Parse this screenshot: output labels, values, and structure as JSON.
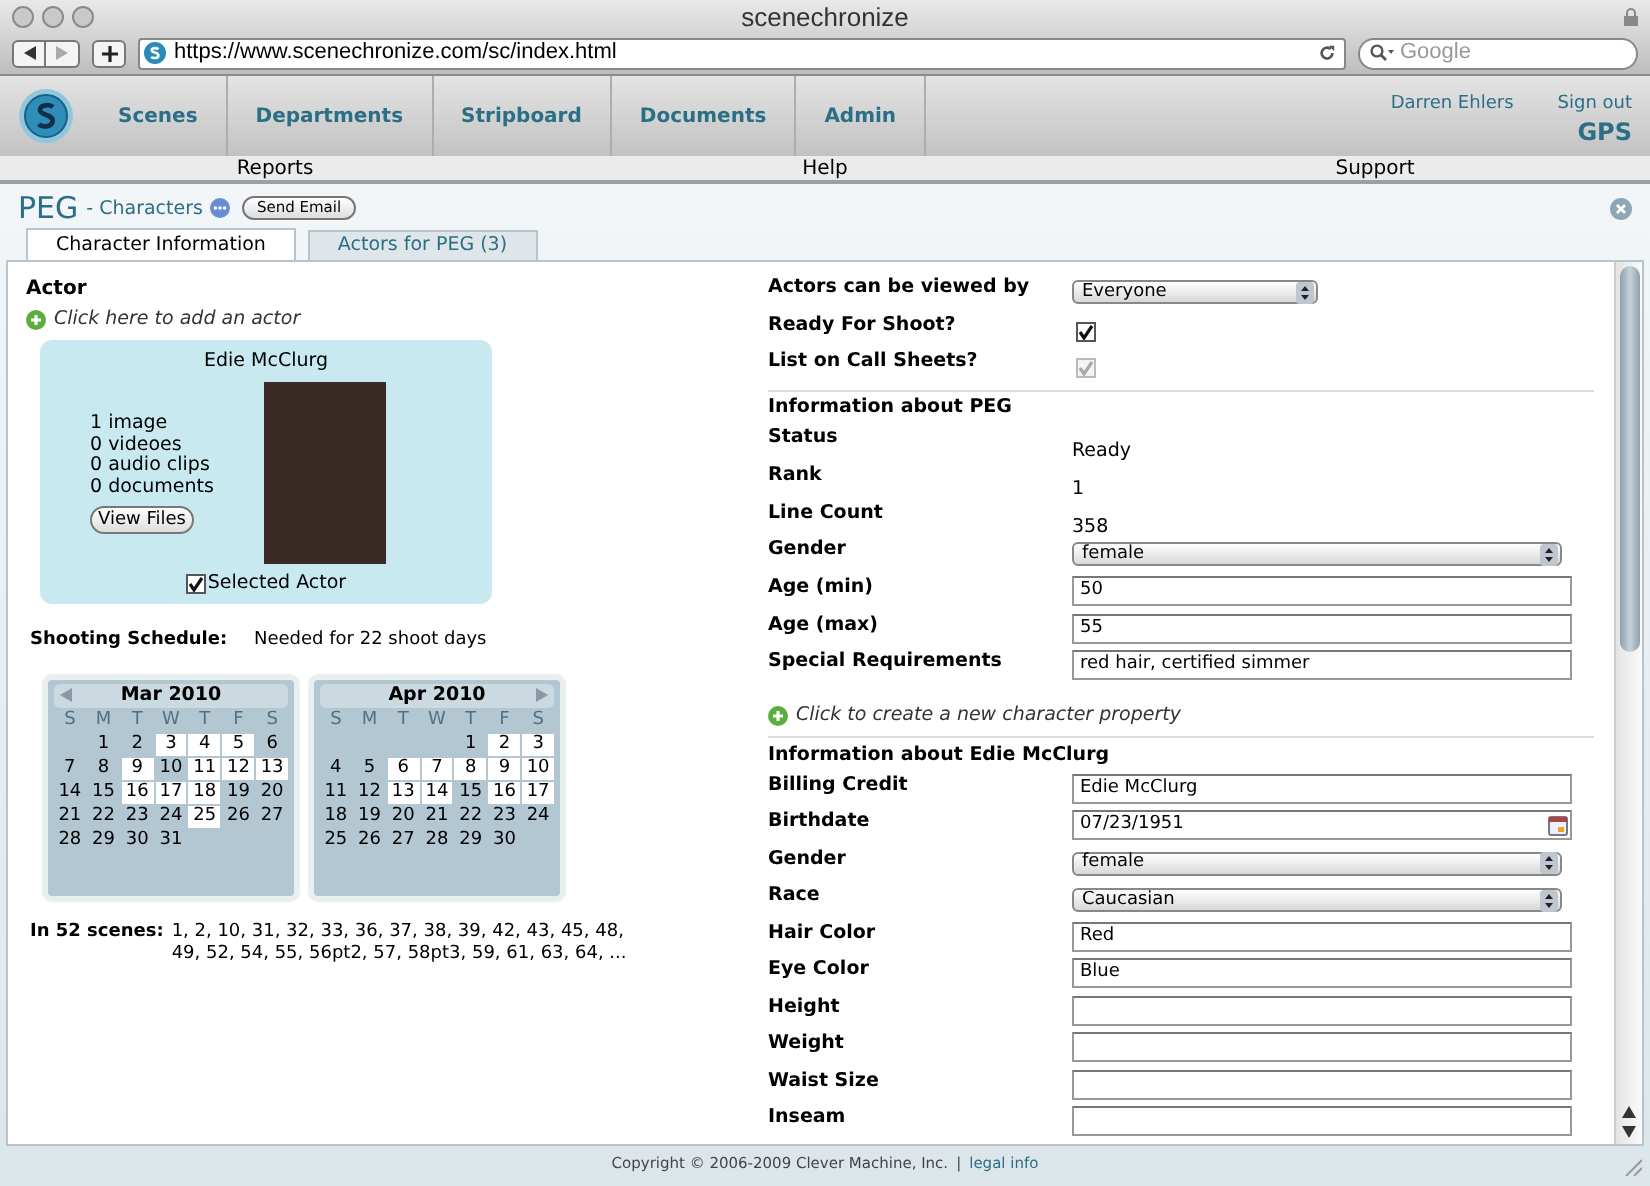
{
  "browser": {
    "title": "scenechronize",
    "url": "https://www.scenechronize.com/sc/index.html",
    "search_placeholder": "Google"
  },
  "nav": {
    "items": [
      {
        "label": "Scenes"
      },
      {
        "label": "Departments"
      },
      {
        "label": "Stripboard"
      },
      {
        "label": "Documents"
      },
      {
        "label": "Admin"
      }
    ],
    "user": "Darren Ehlers",
    "sign_out": "Sign out",
    "location": "GPS"
  },
  "subnav": [
    "Reports",
    "Help",
    "Support"
  ],
  "header": {
    "title": "PEG",
    "subtitle": "- Characters",
    "button": "Send Email"
  },
  "tabs": [
    {
      "label": "Character Information",
      "selected": true
    },
    {
      "label": "Actors for PEG (3)",
      "selected": false
    }
  ],
  "actor": {
    "heading": "Actor",
    "add_link": "Click here to add an actor",
    "card": {
      "name": "Edie McClurg",
      "media": [
        "1 image",
        "0 videoes",
        "0 audio clips",
        "0 documents"
      ],
      "button": "View Files",
      "selected_label": "Selected Actor",
      "selected": true
    }
  },
  "schedule": {
    "label": "Shooting Schedule:",
    "value": "Needed for 22 shoot days"
  },
  "calendars": [
    {
      "title": "Mar 2010",
      "weekdays": [
        "S",
        "M",
        "T",
        "W",
        "T",
        "F",
        "S"
      ],
      "weeks": [
        [
          {
            "kind": "blank"
          },
          {
            "kind": "day",
            "day": "1",
            "shoot_day": false
          },
          {
            "kind": "day",
            "day": "2",
            "shoot_day": false
          },
          {
            "kind": "day",
            "day": "3",
            "shoot_day": true
          },
          {
            "kind": "day",
            "day": "4",
            "shoot_day": true
          },
          {
            "kind": "day",
            "day": "5",
            "shoot_day": true
          },
          {
            "kind": "day",
            "day": "6",
            "shoot_day": false
          }
        ],
        [
          {
            "day": "7",
            "shoot_day": false
          },
          {
            "day": "8",
            "shoot_day": false
          },
          {
            "day": "9",
            "shoot_day": true
          },
          {
            "day": "10",
            "shoot_day": false
          },
          {
            "day": "11",
            "shoot_day": true
          },
          {
            "day": "12",
            "shoot_day": true
          },
          {
            "day": "13",
            "shoot_day": true
          }
        ],
        [
          {
            "day": "14",
            "shoot_day": false
          },
          {
            "day": "15",
            "shoot_day": false
          },
          {
            "day": "16",
            "shoot_day": true
          },
          {
            "day": "17",
            "shoot_day": true
          },
          {
            "day": "18",
            "shoot_day": true
          },
          {
            "day": "19",
            "shoot_day": false
          },
          {
            "day": "20",
            "shoot_day": false
          }
        ],
        [
          {
            "day": "21",
            "shoot_day": false
          },
          {
            "day": "22",
            "shoot_day": false
          },
          {
            "day": "23",
            "shoot_day": false
          },
          {
            "day": "24",
            "shoot_day": false
          },
          {
            "day": "25",
            "shoot_day": true
          },
          {
            "day": "26",
            "shoot_day": false
          },
          {
            "day": "27",
            "shoot_day": false
          }
        ],
        [
          {
            "day": "28",
            "shoot_day": false
          },
          {
            "day": "29",
            "shoot_day": false
          },
          {
            "day": "30",
            "shoot_day": false
          },
          {
            "day": "31",
            "shoot_day": false
          },
          {
            "kind": "blank"
          },
          {
            "kind": "blank"
          },
          {
            "kind": "blank"
          }
        ]
      ]
    },
    {
      "title": "Apr 2010",
      "weekdays": [
        "S",
        "M",
        "T",
        "W",
        "T",
        "F",
        "S"
      ],
      "weeks": [
        [
          {
            "kind": "blank"
          },
          {
            "kind": "blank"
          },
          {
            "kind": "blank"
          },
          {
            "kind": "blank"
          },
          {
            "kind": "day",
            "day": "1",
            "shoot_day": false
          },
          {
            "day": "2",
            "shoot_day": true
          },
          {
            "day": "3",
            "shoot_day": true
          }
        ],
        [
          {
            "day": "4",
            "shoot_day": false
          },
          {
            "day": "5",
            "shoot_day": false
          },
          {
            "day": "6",
            "shoot_day": true
          },
          {
            "day": "7",
            "shoot_day": true
          },
          {
            "day": "8",
            "shoot_day": true
          },
          {
            "day": "9",
            "shoot_day": true
          },
          {
            "day": "10",
            "shoot_day": true
          }
        ],
        [
          {
            "day": "11",
            "shoot_day": false
          },
          {
            "day": "12",
            "shoot_day": false
          },
          {
            "day": "13",
            "shoot_day": true
          },
          {
            "day": "14",
            "shoot_day": true
          },
          {
            "day": "15",
            "shoot_day": false
          },
          {
            "day": "16",
            "shoot_day": true
          },
          {
            "day": "17",
            "shoot_day": true
          }
        ],
        [
          {
            "day": "18",
            "shoot_day": false
          },
          {
            "day": "19",
            "shoot_day": false
          },
          {
            "day": "20",
            "shoot_day": false
          },
          {
            "day": "21",
            "shoot_day": false
          },
          {
            "day": "22",
            "shoot_day": false
          },
          {
            "day": "23",
            "shoot_day": false
          },
          {
            "day": "24",
            "shoot_day": false
          }
        ],
        [
          {
            "day": "25",
            "shoot_day": false
          },
          {
            "day": "26",
            "shoot_day": false
          },
          {
            "day": "27",
            "shoot_day": false
          },
          {
            "day": "28",
            "shoot_day": false
          },
          {
            "day": "29",
            "shoot_day": false
          },
          {
            "day": "30",
            "shoot_day": false
          },
          {
            "kind": "blank"
          }
        ]
      ]
    }
  ],
  "scenes": {
    "label": "In 52 scenes:",
    "lines": [
      "1, 2, 10, 31, 32, 33, 36, 37, 38, 39, 42, 43, 45, 48,",
      "49, 52, 54, 55, 56pt2, 57, 58pt3, 59, 61, 63, 64, ..."
    ]
  },
  "fields": [
    {
      "kind": "short_select",
      "label": "Actors can be viewed by",
      "value": "Everyone"
    },
    {
      "kind": "checkbox",
      "label": "Ready For Shoot?",
      "checked": true,
      "disabled": false
    },
    {
      "kind": "checkbox",
      "label": "List on Call Sheets?",
      "checked": true,
      "disabled": true
    },
    {
      "kind": "section",
      "label": "Information about PEG"
    },
    {
      "kind": "text",
      "label": "Status",
      "value": "Ready"
    },
    {
      "kind": "text",
      "label": "Rank",
      "value": "1"
    },
    {
      "kind": "text",
      "label": "Line Count",
      "value": "358"
    },
    {
      "kind": "select",
      "label": "Gender",
      "value": "female"
    },
    {
      "kind": "input",
      "label": "Age (min)",
      "value": "50"
    },
    {
      "kind": "input",
      "label": "Age (max)",
      "value": "55"
    },
    {
      "kind": "input",
      "label": "Special Requirements",
      "value": "red hair, certified simmer"
    },
    {
      "kind": "add",
      "label": "Click to create a new character property"
    },
    {
      "kind": "section",
      "label": "Information about Edie McClurg"
    },
    {
      "kind": "input",
      "label": "Billing Credit",
      "value": "Edie McClurg"
    },
    {
      "kind": "date",
      "label": "Birthdate",
      "value": "07/23/1951"
    },
    {
      "kind": "select",
      "label": "Gender",
      "value": "female"
    },
    {
      "kind": "select",
      "label": "Race",
      "value": "Caucasian"
    },
    {
      "kind": "input",
      "label": "Hair Color",
      "value": "Red"
    },
    {
      "kind": "input",
      "label": "Eye Color",
      "value": "Blue"
    },
    {
      "kind": "input",
      "label": "Height"
    },
    {
      "kind": "input",
      "label": "Weight"
    },
    {
      "kind": "input",
      "label": "Waist Size"
    },
    {
      "kind": "input",
      "label": "Inseam"
    }
  ],
  "footer": {
    "text": "Copyright © 2006-2009 Clever Machine, Inc.",
    "separator": "|",
    "link": "legal info"
  }
}
